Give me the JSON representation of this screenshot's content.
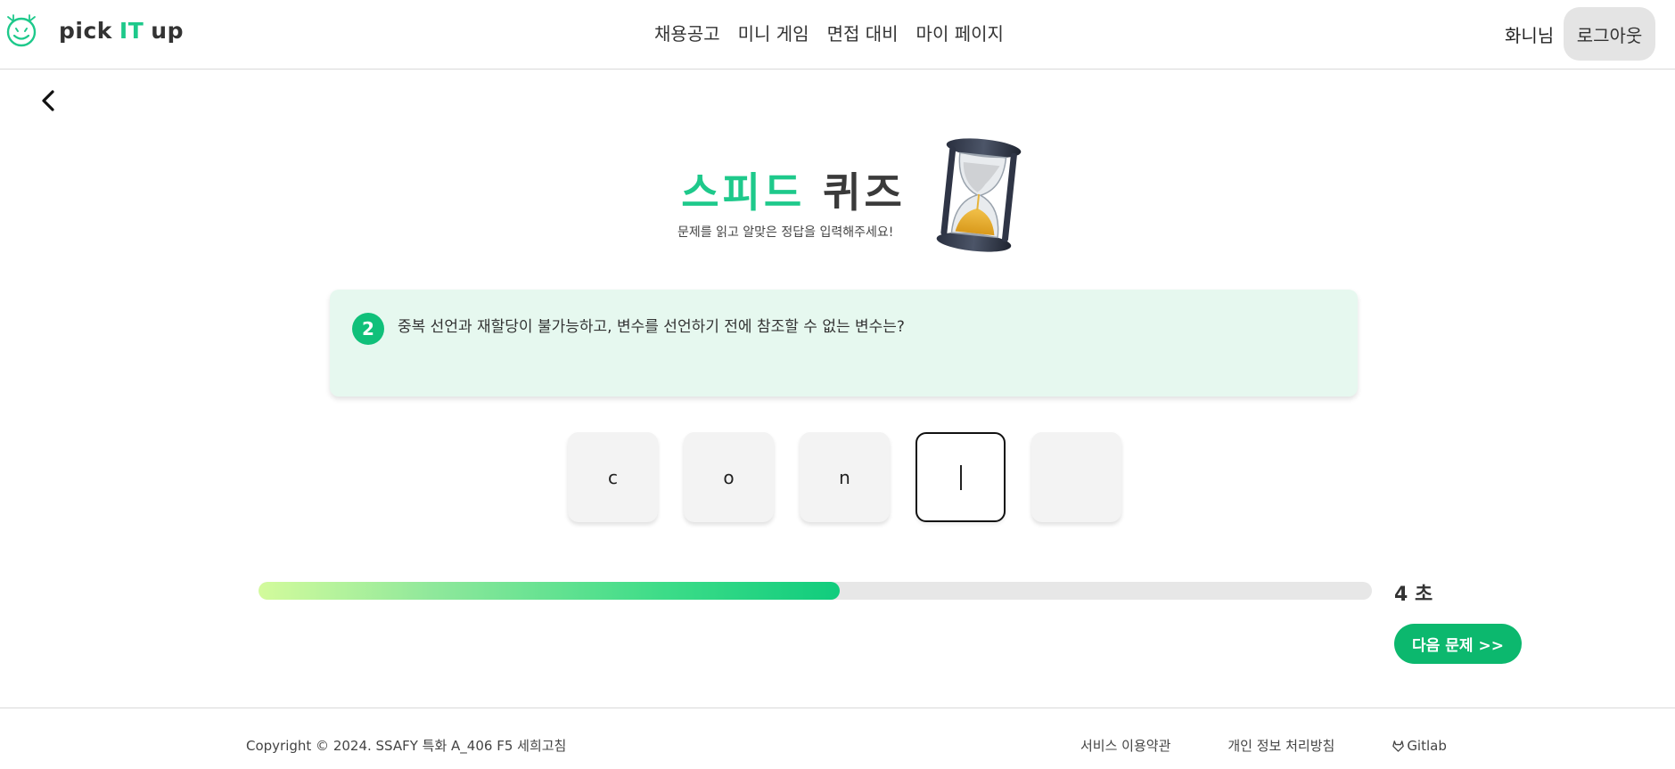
{
  "header": {
    "logo": {
      "prefix": "pick",
      "accent": "IT",
      "suffix": "up",
      "icon": "smiley-logo-icon"
    },
    "nav": [
      "채용공고",
      "미니 게임",
      "면접 대비",
      "마이 페이지"
    ],
    "user_name": "화니님",
    "logout_label": "로그아웃"
  },
  "page": {
    "back_icon": "chevron-left-icon",
    "title_green": "스피드",
    "title_dark": "퀴즈",
    "subtitle": "문제를 읽고 알맞은 정답을 입력해주세요!",
    "hourglass_icon": "hourglass-icon"
  },
  "question": {
    "number": "2",
    "text": "중복 선언과 재할당이 불가능하고, 변수를 선언하기 전에 참조할 수 없는 변수는?"
  },
  "answer": {
    "letters": [
      "c",
      "o",
      "n",
      "",
      ""
    ],
    "active_index": 3
  },
  "timer": {
    "progress_fraction": 0.522,
    "label": "4 초"
  },
  "next_button": "다음 문제 >>",
  "footer": {
    "copyright": "Copyright © 2024. SSAFY 특화 A_406 F5 세희고침",
    "links": [
      "서비스 이용약관",
      "개인 정보 처리방침",
      "Gitlab"
    ]
  },
  "colors": {
    "accent_green": "#1ec98b",
    "button_green": "#0cb86e",
    "question_bg": "#e6f8ef"
  }
}
